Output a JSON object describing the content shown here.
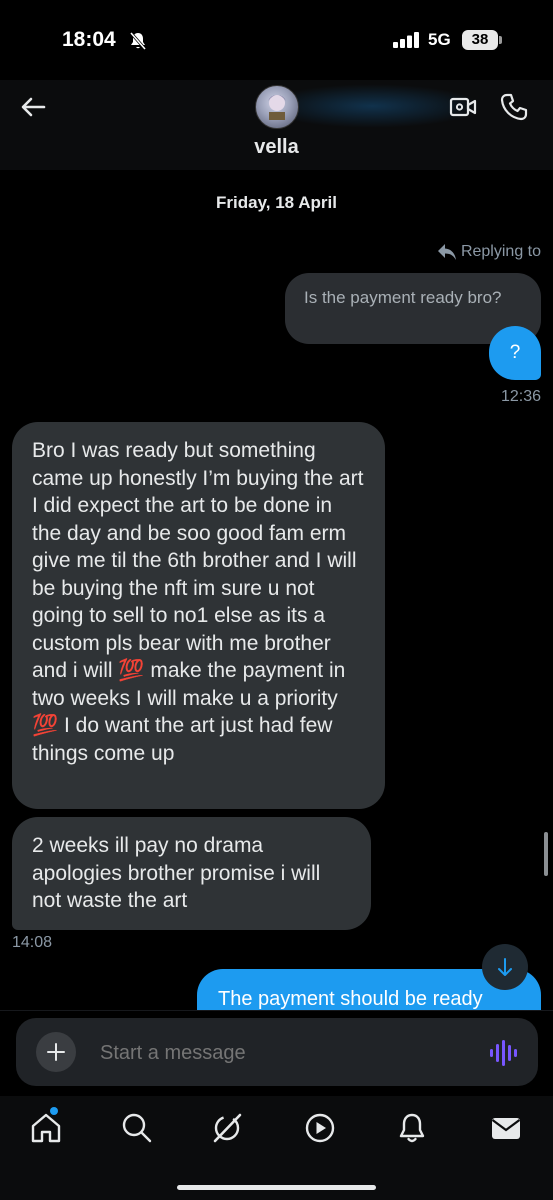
{
  "status_bar": {
    "time": "18:04",
    "network": "5G",
    "battery": "38"
  },
  "header": {
    "contact_name": "vella"
  },
  "conversation": {
    "date_separator": "Friday, 18 April",
    "reply_tag": "Replying to",
    "quoted_message": "Is the payment ready bro?",
    "sent_message": "?",
    "sent_time": "12:36",
    "received_messages": [
      "Bro I was ready but something came up honestly I’m buying the art I did expect the art to be done in the day and be soo good fam erm give me til the 6th brother and I will be buying the nft im sure u not going to sell to no1 else as its a custom pls bear with me brother and i will 💯 make the payment in two weeks I will make u a priority 💯 I do want the art just had few things come up",
      "2 weeks ill pay no drama apologies brother promise i will not waste the art"
    ],
    "received_time": "14:08",
    "outgoing_partial": "The payment should be ready"
  },
  "composer": {
    "placeholder": "Start a message"
  },
  "tab_bar": {
    "items": [
      "home-icon",
      "search-icon",
      "grok-icon",
      "video-icon",
      "notifications-icon",
      "messages-icon"
    ]
  },
  "colors": {
    "accent": "#1d9bf0",
    "bubble_in": "#2f3336",
    "background": "#000000"
  }
}
